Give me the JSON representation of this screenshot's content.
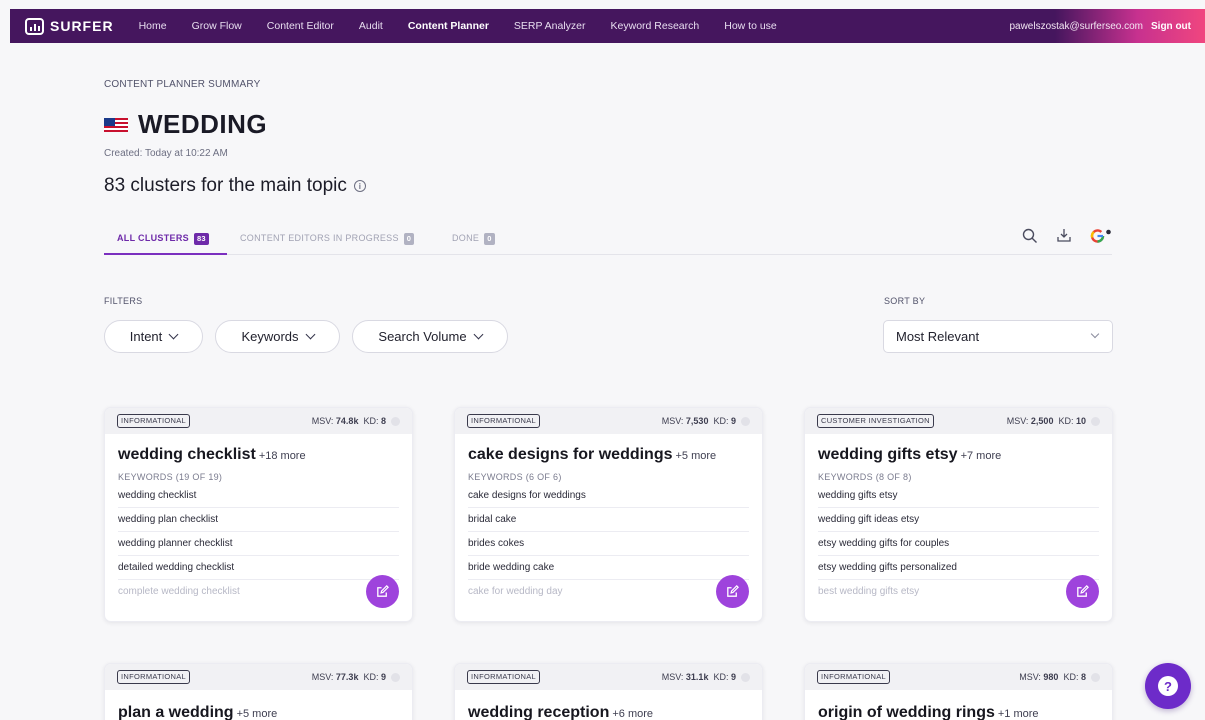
{
  "nav": {
    "brand": "SURFER",
    "links": [
      "Home",
      "Grow Flow",
      "Content Editor",
      "Audit",
      "Content Planner",
      "SERP Analyzer",
      "Keyword Research",
      "How to use"
    ],
    "active": "Content Planner",
    "email": "pawelszostak@surferseo.com",
    "signout": "Sign out"
  },
  "header": {
    "summary_label": "CONTENT PLANNER SUMMARY",
    "title": "WEDDING",
    "created": "Created: Today at 10:22 AM",
    "clusters_text": "83 clusters for the main topic"
  },
  "tabs": [
    {
      "label": "ALL CLUSTERS",
      "count": "83",
      "active": true
    },
    {
      "label": "CONTENT EDITORS IN PROGRESS",
      "count": "0",
      "active": false
    },
    {
      "label": "DONE",
      "count": "0",
      "active": false
    }
  ],
  "filters": {
    "label": "FILTERS",
    "items": [
      "Intent",
      "Keywords",
      "Search Volume"
    ]
  },
  "sort": {
    "label": "SORT BY",
    "value": "Most Relevant"
  },
  "cards": [
    {
      "intent": "INFORMATIONAL",
      "msv_label": "MSV:",
      "msv": "74.8k",
      "kd_label": "KD:",
      "kd": "8",
      "title": "wedding checklist",
      "more": "+18 more",
      "kw_head": "KEYWORDS (19 OF 19)",
      "keywords": [
        "wedding checklist",
        "wedding plan checklist",
        "wedding planner checklist",
        "detailed wedding checklist",
        "complete wedding checklist"
      ]
    },
    {
      "intent": "INFORMATIONAL",
      "msv_label": "MSV:",
      "msv": "7,530",
      "kd_label": "KD:",
      "kd": "9",
      "title": "cake designs for weddings",
      "more": "+5 more",
      "kw_head": "KEYWORDS (6 OF 6)",
      "keywords": [
        "cake designs for weddings",
        "bridal cake",
        "brides cokes",
        "bride wedding cake",
        "cake for wedding day"
      ]
    },
    {
      "intent": "CUSTOMER INVESTIGATION",
      "msv_label": "MSV:",
      "msv": "2,500",
      "kd_label": "KD:",
      "kd": "10",
      "title": "wedding gifts etsy",
      "more": "+7 more",
      "kw_head": "KEYWORDS (8 OF 8)",
      "keywords": [
        "wedding gifts etsy",
        "wedding gift ideas etsy",
        "etsy wedding gifts for couples",
        "etsy wedding gifts personalized",
        "best wedding gifts etsy"
      ]
    },
    {
      "intent": "INFORMATIONAL",
      "msv_label": "MSV:",
      "msv": "77.3k",
      "kd_label": "KD:",
      "kd": "9",
      "title": "plan a wedding",
      "more": "+5 more"
    },
    {
      "intent": "INFORMATIONAL",
      "msv_label": "MSV:",
      "msv": "31.1k",
      "kd_label": "KD:",
      "kd": "9",
      "title": "wedding reception",
      "more": "+6 more"
    },
    {
      "intent": "INFORMATIONAL",
      "msv_label": "MSV:",
      "msv": "980",
      "kd_label": "KD:",
      "kd": "8",
      "title": "origin of wedding rings",
      "more": "+1 more"
    }
  ],
  "colors": {
    "nav_bg": "#45165e",
    "accent": "#7b2fbf",
    "edit_button": "#9e43dc",
    "help_button": "#6d2bc9"
  },
  "icons": [
    "search-icon",
    "download-icon",
    "google-icon",
    "info-icon",
    "chevron-down-icon",
    "edit-icon",
    "help-icon",
    "us-flag-icon"
  ]
}
